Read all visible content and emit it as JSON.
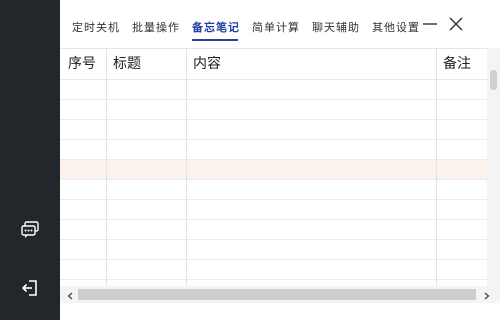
{
  "tabs": [
    {
      "label": "定时关机"
    },
    {
      "label": "批量操作"
    },
    {
      "label": "备忘笔记",
      "active": true
    },
    {
      "label": "简单计算"
    },
    {
      "label": "聊天辅助"
    },
    {
      "label": "其他设置"
    }
  ],
  "table": {
    "columns": [
      "序号",
      "标题",
      "内容",
      "备注"
    ],
    "rows": []
  },
  "sidebar": {
    "icons": [
      "chat-icon",
      "exit-icon"
    ]
  },
  "colors": {
    "sidebar_bg": "#23262b",
    "active_tab": "#1f3fa3",
    "highlight_row": "#fbf1ed"
  }
}
